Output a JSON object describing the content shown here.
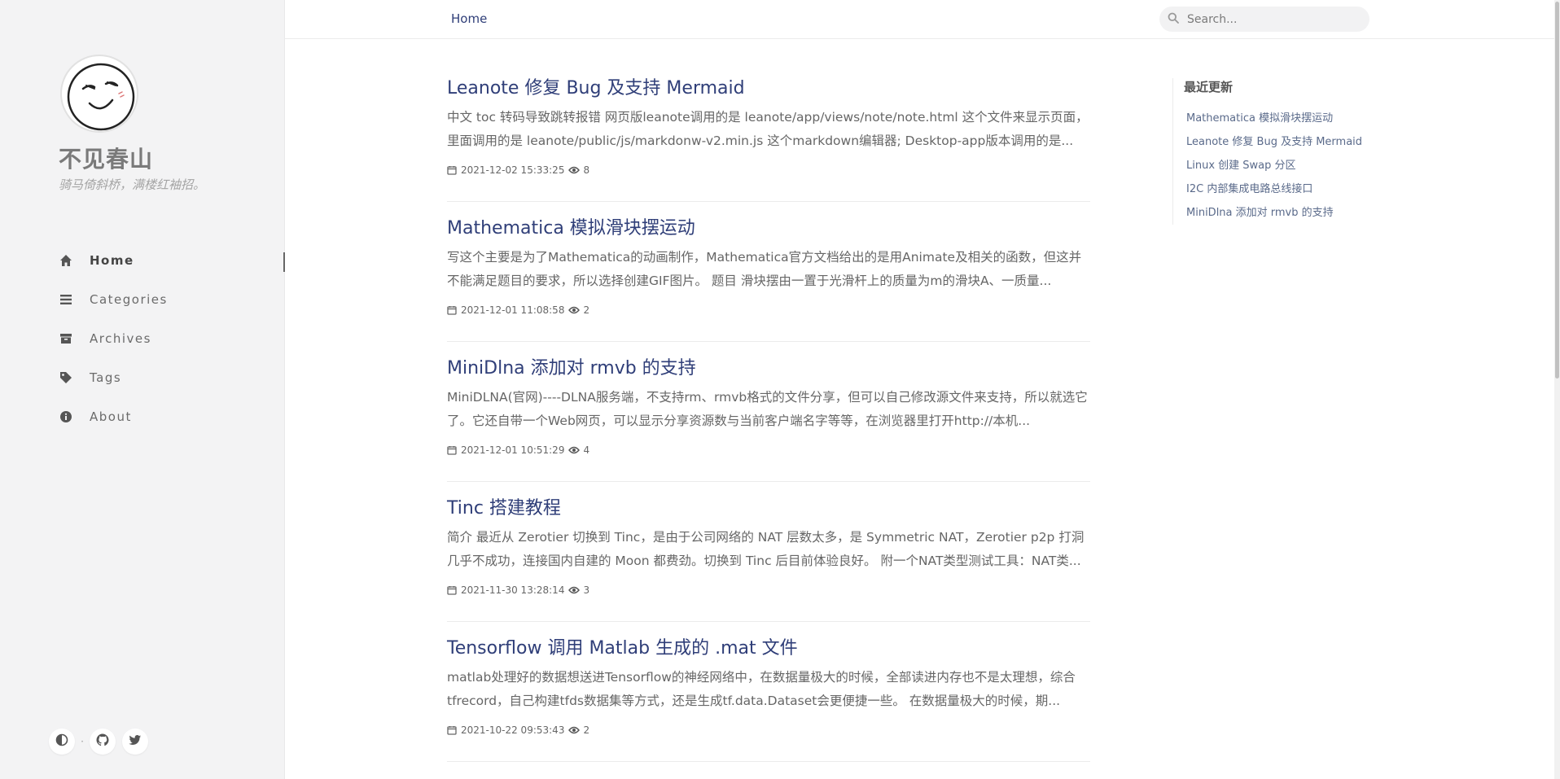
{
  "sidebar": {
    "site_title": "不见春山",
    "site_subtitle": "骑马倚斜桥，满楼红袖招。",
    "nav": [
      {
        "label": "Home",
        "icon": "home-icon",
        "active": true
      },
      {
        "label": "Categories",
        "icon": "list-icon",
        "active": false
      },
      {
        "label": "Archives",
        "icon": "archive-icon",
        "active": false
      },
      {
        "label": "Tags",
        "icon": "tag-icon",
        "active": false
      },
      {
        "label": "About",
        "icon": "info-icon",
        "active": false
      }
    ],
    "footer_icons": [
      "theme-toggle-icon",
      "github-icon",
      "twitter-icon"
    ]
  },
  "topbar": {
    "home_label": "Home",
    "search_placeholder": "Search..."
  },
  "posts": [
    {
      "title": "Leanote 修复 Bug 及支持 Mermaid",
      "excerpt": "中文 toc 转码导致跳转报错 网页版leanote调用的是 leanote/app/views/note/note.html 这个文件来显示页面，里面调用的是 leanote/public/js/markdonw-v2.min.js 这个markdown编辑器; Desktop-app版本调用的是...",
      "date": "2021-12-02 15:33:25",
      "views": "8"
    },
    {
      "title": "Mathematica 模拟滑块摆运动",
      "excerpt": "写这个主要是为了Mathematica的动画制作，Mathematica官方文档给出的是用Animate及相关的函数，但这并不能满足题目的要求，所以选择创建GIF图片。 题目 滑块摆由一置于光滑杆上的质量为m的滑块A、一质量...",
      "date": "2021-12-01 11:08:58",
      "views": "2"
    },
    {
      "title": "MiniDlna 添加对 rmvb 的支持",
      "excerpt": "MiniDLNA(官网)----DLNA服务端，不支持rm、rmvb格式的文件分享，但可以自己修改源文件来支持，所以就选它了。它还自带一个Web网页，可以显示分享资源数与当前客户端名字等等，在浏览器里打开http://本机...",
      "date": "2021-12-01 10:51:29",
      "views": "4"
    },
    {
      "title": "Tinc 搭建教程",
      "excerpt": "简介 最近从 Zerotier 切换到 Tinc，是由于公司网络的 NAT 层数太多，是 Symmetric NAT，Zerotier p2p 打洞几乎不成功，连接国内自建的 Moon 都费劲。切换到 Tinc 后目前体验良好。 附一个NAT类型测试工具：NAT类...",
      "date": "2021-11-30 13:28:14",
      "views": "3"
    },
    {
      "title": "Tensorflow 调用 Matlab 生成的 .mat 文件",
      "excerpt": "matlab处理好的数据想送进Tensorflow的神经网络中，在数据量极大的时候，全部读进内存也不是太理想，综合tfrecord，自己构建tfds数据集等方式，还是生成tf.data.Dataset会更便捷一些。 在数据量极大的时候，期...",
      "date": "2021-10-22 09:53:43",
      "views": "2"
    }
  ],
  "recent": {
    "title": "最近更新",
    "items": [
      "Mathematica 模拟滑块摆运动",
      "Leanote 修复 Bug 及支持 Mermaid",
      "Linux 创建 Swap 分区",
      "I2C 内部集成电路总线接口",
      "MiniDlna 添加对 rmvb 的支持"
    ]
  },
  "colors": {
    "link": "#2f3e78",
    "sidebar_bg": "#f3f3f4",
    "text": "#666666"
  }
}
